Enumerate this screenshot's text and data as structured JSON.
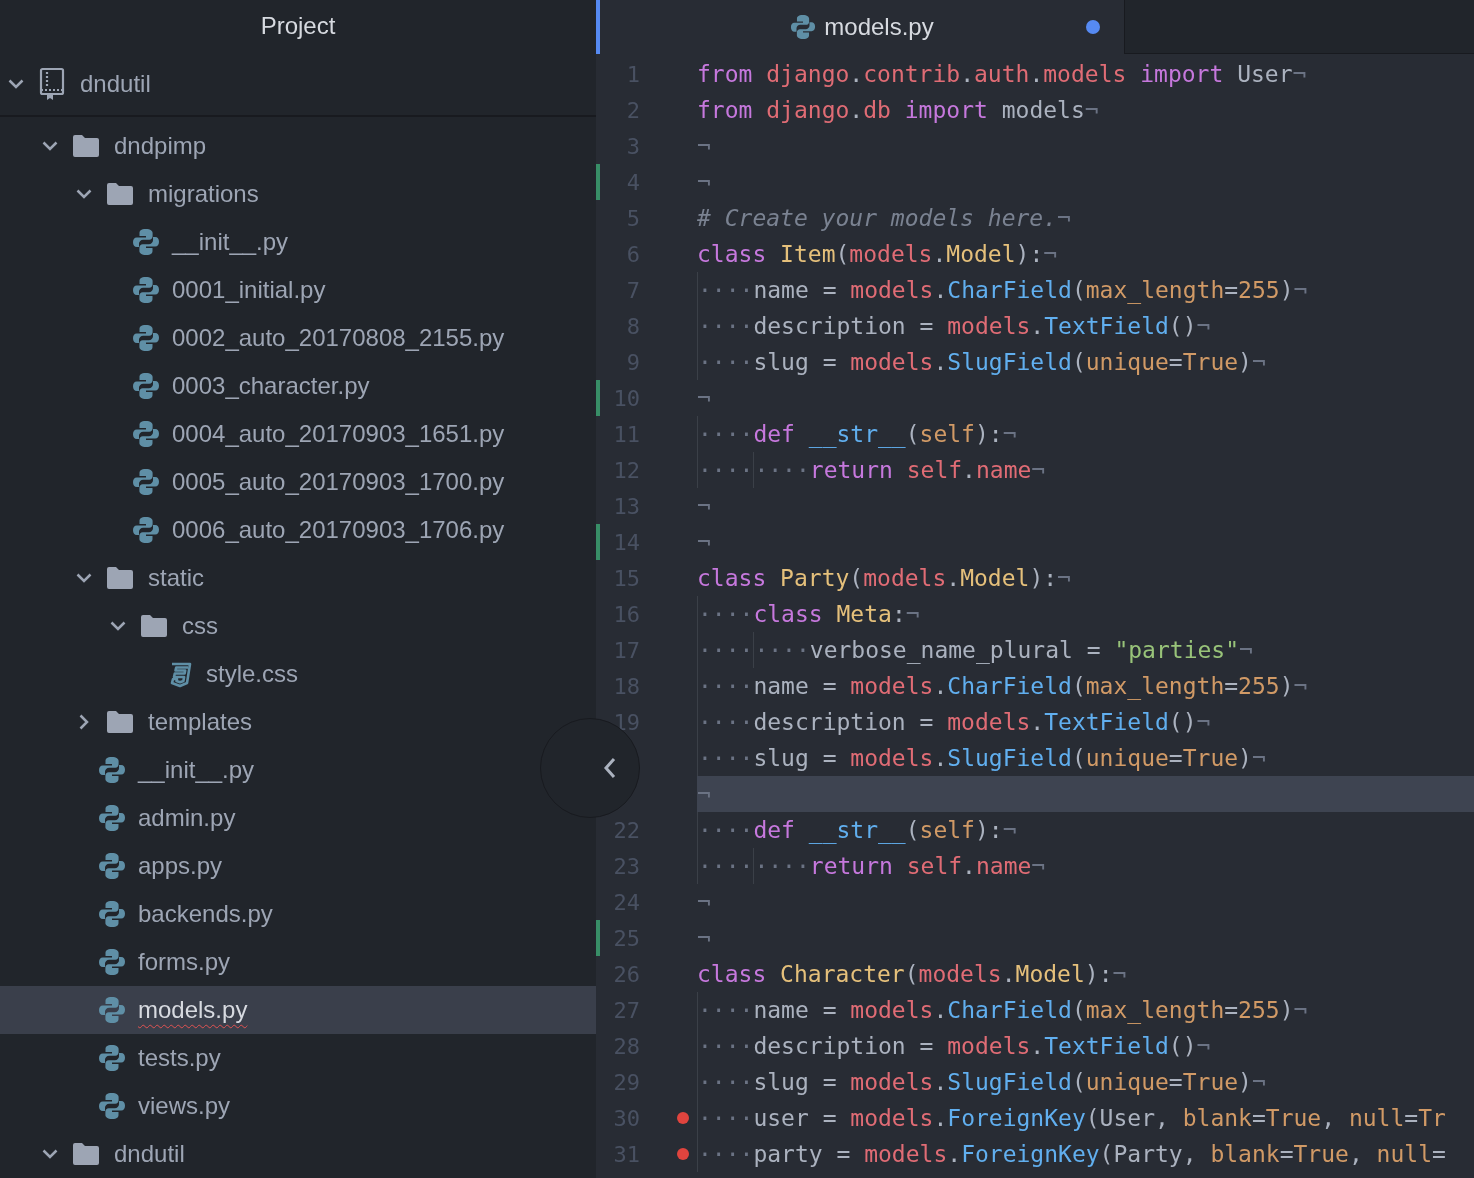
{
  "sidebar": {
    "title": "Project",
    "root": {
      "name": "dndutil",
      "kind": "repo",
      "expanded": true,
      "children": [
        {
          "name": "dndpimp",
          "kind": "folder",
          "expanded": true,
          "children": [
            {
              "name": "migrations",
              "kind": "folder",
              "expanded": true,
              "children": [
                {
                  "name": "__init__.py",
                  "kind": "python",
                  "selected": false,
                  "flagged": false
                },
                {
                  "name": "0001_initial.py",
                  "kind": "python",
                  "selected": false,
                  "flagged": false
                },
                {
                  "name": "0002_auto_20170808_2155.py",
                  "kind": "python",
                  "selected": false,
                  "flagged": false
                },
                {
                  "name": "0003_character.py",
                  "kind": "python",
                  "selected": false,
                  "flagged": false
                },
                {
                  "name": "0004_auto_20170903_1651.py",
                  "kind": "python",
                  "selected": false,
                  "flagged": false
                },
                {
                  "name": "0005_auto_20170903_1700.py",
                  "kind": "python",
                  "selected": false,
                  "flagged": false
                },
                {
                  "name": "0006_auto_20170903_1706.py",
                  "kind": "python",
                  "selected": false,
                  "flagged": false
                }
              ]
            },
            {
              "name": "static",
              "kind": "folder",
              "expanded": true,
              "children": [
                {
                  "name": "css",
                  "kind": "folder",
                  "expanded": true,
                  "children": [
                    {
                      "name": "style.css",
                      "kind": "css",
                      "selected": false,
                      "flagged": false
                    }
                  ]
                }
              ]
            },
            {
              "name": "templates",
              "kind": "folder",
              "expanded": false
            },
            {
              "name": "__init__.py",
              "kind": "python",
              "selected": false,
              "flagged": false
            },
            {
              "name": "admin.py",
              "kind": "python",
              "selected": false,
              "flagged": false
            },
            {
              "name": "apps.py",
              "kind": "python",
              "selected": false,
              "flagged": false
            },
            {
              "name": "backends.py",
              "kind": "python",
              "selected": false,
              "flagged": false
            },
            {
              "name": "forms.py",
              "kind": "python",
              "selected": false,
              "flagged": false
            },
            {
              "name": "models.py",
              "kind": "python",
              "selected": true,
              "flagged": true
            },
            {
              "name": "tests.py",
              "kind": "python",
              "selected": false,
              "flagged": false
            },
            {
              "name": "views.py",
              "kind": "python",
              "selected": false,
              "flagged": false
            }
          ]
        },
        {
          "name": "dndutil",
          "kind": "folder",
          "expanded": true
        }
      ]
    }
  },
  "tab": {
    "title": "models.py",
    "modified": true
  },
  "lines": [
    {
      "number": "1",
      "git_added": false,
      "marker": false,
      "cursor": false,
      "tokens": [
        {
          "text": "from ",
          "kind": "keyword"
        },
        {
          "text": "django",
          "kind": "module"
        },
        {
          "text": ".",
          "kind": "plain"
        },
        {
          "text": "contrib",
          "kind": "module"
        },
        {
          "text": ".",
          "kind": "plain"
        },
        {
          "text": "auth",
          "kind": "module"
        },
        {
          "text": ".",
          "kind": "plain"
        },
        {
          "text": "models ",
          "kind": "module"
        },
        {
          "text": "import ",
          "kind": "keyword"
        },
        {
          "text": "User",
          "kind": "plain"
        },
        {
          "text": "¬",
          "kind": "eol"
        }
      ]
    },
    {
      "number": "2",
      "git_added": false,
      "marker": false,
      "cursor": false,
      "tokens": [
        {
          "text": "from ",
          "kind": "keyword"
        },
        {
          "text": "django",
          "kind": "module"
        },
        {
          "text": ".",
          "kind": "plain"
        },
        {
          "text": "db ",
          "kind": "module"
        },
        {
          "text": "import ",
          "kind": "keyword"
        },
        {
          "text": "models",
          "kind": "plain"
        },
        {
          "text": "¬",
          "kind": "eol"
        }
      ]
    },
    {
      "number": "3",
      "git_added": false,
      "marker": false,
      "cursor": false,
      "tokens": [
        {
          "text": "¬",
          "kind": "eol"
        }
      ]
    },
    {
      "number": "4",
      "git_added": true,
      "marker": false,
      "cursor": false,
      "tokens": [
        {
          "text": "¬",
          "kind": "eol"
        }
      ]
    },
    {
      "number": "5",
      "git_added": false,
      "marker": false,
      "cursor": false,
      "tokens": [
        {
          "text": "# Create your models here.",
          "kind": "comment"
        },
        {
          "text": "¬",
          "kind": "eol"
        }
      ]
    },
    {
      "number": "6",
      "git_added": false,
      "marker": false,
      "cursor": false,
      "tokens": [
        {
          "text": "class ",
          "kind": "keyword"
        },
        {
          "text": "Item",
          "kind": "class"
        },
        {
          "text": "(",
          "kind": "plain"
        },
        {
          "text": "models",
          "kind": "module"
        },
        {
          "text": ".",
          "kind": "plain"
        },
        {
          "text": "Model",
          "kind": "class"
        },
        {
          "text": "):",
          "kind": "plain"
        },
        {
          "text": "¬",
          "kind": "eol"
        }
      ]
    },
    {
      "number": "7",
      "git_added": false,
      "marker": false,
      "cursor": false,
      "tokens": [
        {
          "text": "····",
          "kind": "indent"
        },
        {
          "text": "name = ",
          "kind": "plain"
        },
        {
          "text": "models",
          "kind": "module"
        },
        {
          "text": ".",
          "kind": "plain"
        },
        {
          "text": "CharField",
          "kind": "function"
        },
        {
          "text": "(",
          "kind": "plain"
        },
        {
          "text": "max_length",
          "kind": "param"
        },
        {
          "text": "=",
          "kind": "plain"
        },
        {
          "text": "255",
          "kind": "param"
        },
        {
          "text": ")",
          "kind": "plain"
        },
        {
          "text": "¬",
          "kind": "eol"
        }
      ]
    },
    {
      "number": "8",
      "git_added": false,
      "marker": false,
      "cursor": false,
      "tokens": [
        {
          "text": "····",
          "kind": "indent"
        },
        {
          "text": "description = ",
          "kind": "plain"
        },
        {
          "text": "models",
          "kind": "module"
        },
        {
          "text": ".",
          "kind": "plain"
        },
        {
          "text": "TextField",
          "kind": "function"
        },
        {
          "text": "()",
          "kind": "plain"
        },
        {
          "text": "¬",
          "kind": "eol"
        }
      ]
    },
    {
      "number": "9",
      "git_added": false,
      "marker": false,
      "cursor": false,
      "tokens": [
        {
          "text": "····",
          "kind": "indent"
        },
        {
          "text": "slug = ",
          "kind": "plain"
        },
        {
          "text": "models",
          "kind": "module"
        },
        {
          "text": ".",
          "kind": "plain"
        },
        {
          "text": "SlugField",
          "kind": "function"
        },
        {
          "text": "(",
          "kind": "plain"
        },
        {
          "text": "unique",
          "kind": "param"
        },
        {
          "text": "=",
          "kind": "plain"
        },
        {
          "text": "True",
          "kind": "param"
        },
        {
          "text": ")",
          "kind": "plain"
        },
        {
          "text": "¬",
          "kind": "eol"
        }
      ]
    },
    {
      "number": "10",
      "git_added": true,
      "marker": false,
      "cursor": false,
      "tokens": [
        {
          "text": "¬",
          "kind": "eol"
        }
      ]
    },
    {
      "number": "11",
      "git_added": false,
      "marker": false,
      "cursor": false,
      "tokens": [
        {
          "text": "····",
          "kind": "indent"
        },
        {
          "text": "def ",
          "kind": "keyword"
        },
        {
          "text": "__str__",
          "kind": "function"
        },
        {
          "text": "(",
          "kind": "plain"
        },
        {
          "text": "self",
          "kind": "param"
        },
        {
          "text": "):",
          "kind": "plain"
        },
        {
          "text": "¬",
          "kind": "eol"
        }
      ]
    },
    {
      "number": "12",
      "git_added": false,
      "marker": false,
      "cursor": false,
      "tokens": [
        {
          "text": "····",
          "kind": "indent"
        },
        {
          "text": "····",
          "kind": "indent"
        },
        {
          "text": "return ",
          "kind": "keyword"
        },
        {
          "text": "self",
          "kind": "module"
        },
        {
          "text": ".",
          "kind": "plain"
        },
        {
          "text": "name",
          "kind": "module"
        },
        {
          "text": "¬",
          "kind": "eol"
        }
      ]
    },
    {
      "number": "13",
      "git_added": false,
      "marker": false,
      "cursor": false,
      "tokens": [
        {
          "text": "¬",
          "kind": "eol"
        }
      ]
    },
    {
      "number": "14",
      "git_added": true,
      "marker": false,
      "cursor": false,
      "tokens": [
        {
          "text": "¬",
          "kind": "eol"
        }
      ]
    },
    {
      "number": "15",
      "git_added": false,
      "marker": false,
      "cursor": false,
      "tokens": [
        {
          "text": "class ",
          "kind": "keyword"
        },
        {
          "text": "Party",
          "kind": "class"
        },
        {
          "text": "(",
          "kind": "plain"
        },
        {
          "text": "models",
          "kind": "module"
        },
        {
          "text": ".",
          "kind": "plain"
        },
        {
          "text": "Model",
          "kind": "class"
        },
        {
          "text": "):",
          "kind": "plain"
        },
        {
          "text": "¬",
          "kind": "eol"
        }
      ]
    },
    {
      "number": "16",
      "git_added": false,
      "marker": false,
      "cursor": false,
      "tokens": [
        {
          "text": "····",
          "kind": "indent"
        },
        {
          "text": "class ",
          "kind": "keyword"
        },
        {
          "text": "Meta",
          "kind": "class"
        },
        {
          "text": ":",
          "kind": "plain"
        },
        {
          "text": "¬",
          "kind": "eol"
        }
      ]
    },
    {
      "number": "17",
      "git_added": false,
      "marker": false,
      "cursor": false,
      "tokens": [
        {
          "text": "····",
          "kind": "indent"
        },
        {
          "text": "····",
          "kind": "indent"
        },
        {
          "text": "verbose_name_plural = ",
          "kind": "plain"
        },
        {
          "text": "\"parties\"",
          "kind": "string"
        },
        {
          "text": "¬",
          "kind": "eol"
        }
      ]
    },
    {
      "number": "18",
      "git_added": false,
      "marker": false,
      "cursor": false,
      "tokens": [
        {
          "text": "····",
          "kind": "indent"
        },
        {
          "text": "name = ",
          "kind": "plain"
        },
        {
          "text": "models",
          "kind": "module"
        },
        {
          "text": ".",
          "kind": "plain"
        },
        {
          "text": "CharField",
          "kind": "function"
        },
        {
          "text": "(",
          "kind": "plain"
        },
        {
          "text": "max_length",
          "kind": "param"
        },
        {
          "text": "=",
          "kind": "plain"
        },
        {
          "text": "255",
          "kind": "param"
        },
        {
          "text": ")",
          "kind": "plain"
        },
        {
          "text": "¬",
          "kind": "eol"
        }
      ]
    },
    {
      "number": "19",
      "git_added": false,
      "marker": false,
      "cursor": false,
      "tokens": [
        {
          "text": "····",
          "kind": "indent"
        },
        {
          "text": "description = ",
          "kind": "plain"
        },
        {
          "text": "models",
          "kind": "module"
        },
        {
          "text": ".",
          "kind": "plain"
        },
        {
          "text": "TextField",
          "kind": "function"
        },
        {
          "text": "()",
          "kind": "plain"
        },
        {
          "text": "¬",
          "kind": "eol"
        }
      ]
    },
    {
      "git_added": false,
      "marker": false,
      "cursor": false,
      "tokens": [
        {
          "text": "····",
          "kind": "indent"
        },
        {
          "text": "slug = ",
          "kind": "plain"
        },
        {
          "text": "models",
          "kind": "module"
        },
        {
          "text": ".",
          "kind": "plain"
        },
        {
          "text": "SlugField",
          "kind": "function"
        },
        {
          "text": "(",
          "kind": "plain"
        },
        {
          "text": "unique",
          "kind": "param"
        },
        {
          "text": "=",
          "kind": "plain"
        },
        {
          "text": "True",
          "kind": "param"
        },
        {
          "text": ")",
          "kind": "plain"
        },
        {
          "text": "¬",
          "kind": "eol"
        }
      ]
    },
    {
      "git_added": false,
      "marker": false,
      "cursor": true,
      "tokens": [
        {
          "text": "¬",
          "kind": "eol"
        }
      ]
    },
    {
      "number": "22",
      "git_added": false,
      "marker": false,
      "cursor": false,
      "tokens": [
        {
          "text": "····",
          "kind": "indent"
        },
        {
          "text": "def ",
          "kind": "keyword"
        },
        {
          "text": "__str__",
          "kind": "function"
        },
        {
          "text": "(",
          "kind": "plain"
        },
        {
          "text": "self",
          "kind": "param"
        },
        {
          "text": "):",
          "kind": "plain"
        },
        {
          "text": "¬",
          "kind": "eol"
        }
      ]
    },
    {
      "number": "23",
      "git_added": false,
      "marker": false,
      "cursor": false,
      "tokens": [
        {
          "text": "····",
          "kind": "indent"
        },
        {
          "text": "····",
          "kind": "indent"
        },
        {
          "text": "return ",
          "kind": "keyword"
        },
        {
          "text": "self",
          "kind": "module"
        },
        {
          "text": ".",
          "kind": "plain"
        },
        {
          "text": "name",
          "kind": "module"
        },
        {
          "text": "¬",
          "kind": "eol"
        }
      ]
    },
    {
      "number": "24",
      "git_added": false,
      "marker": false,
      "cursor": false,
      "tokens": [
        {
          "text": "¬",
          "kind": "eol"
        }
      ]
    },
    {
      "number": "25",
      "git_added": true,
      "marker": false,
      "cursor": false,
      "tokens": [
        {
          "text": "¬",
          "kind": "eol"
        }
      ]
    },
    {
      "number": "26",
      "git_added": false,
      "marker": false,
      "cursor": false,
      "tokens": [
        {
          "text": "class ",
          "kind": "keyword"
        },
        {
          "text": "Character",
          "kind": "class"
        },
        {
          "text": "(",
          "kind": "plain"
        },
        {
          "text": "models",
          "kind": "module"
        },
        {
          "text": ".",
          "kind": "plain"
        },
        {
          "text": "Model",
          "kind": "class"
        },
        {
          "text": "):",
          "kind": "plain"
        },
        {
          "text": "¬",
          "kind": "eol"
        }
      ]
    },
    {
      "number": "27",
      "git_added": false,
      "marker": false,
      "cursor": false,
      "tokens": [
        {
          "text": "····",
          "kind": "indent"
        },
        {
          "text": "name = ",
          "kind": "plain"
        },
        {
          "text": "models",
          "kind": "module"
        },
        {
          "text": ".",
          "kind": "plain"
        },
        {
          "text": "CharField",
          "kind": "function"
        },
        {
          "text": "(",
          "kind": "plain"
        },
        {
          "text": "max_length",
          "kind": "param"
        },
        {
          "text": "=",
          "kind": "plain"
        },
        {
          "text": "255",
          "kind": "param"
        },
        {
          "text": ")",
          "kind": "plain"
        },
        {
          "text": "¬",
          "kind": "eol"
        }
      ]
    },
    {
      "number": "28",
      "git_added": false,
      "marker": false,
      "cursor": false,
      "tokens": [
        {
          "text": "····",
          "kind": "indent"
        },
        {
          "text": "description = ",
          "kind": "plain"
        },
        {
          "text": "models",
          "kind": "module"
        },
        {
          "text": ".",
          "kind": "plain"
        },
        {
          "text": "TextField",
          "kind": "function"
        },
        {
          "text": "()",
          "kind": "plain"
        },
        {
          "text": "¬",
          "kind": "eol"
        }
      ]
    },
    {
      "number": "29",
      "git_added": false,
      "marker": false,
      "cursor": false,
      "tokens": [
        {
          "text": "····",
          "kind": "indent"
        },
        {
          "text": "slug = ",
          "kind": "plain"
        },
        {
          "text": "models",
          "kind": "module"
        },
        {
          "text": ".",
          "kind": "plain"
        },
        {
          "text": "SlugField",
          "kind": "function"
        },
        {
          "text": "(",
          "kind": "plain"
        },
        {
          "text": "unique",
          "kind": "param"
        },
        {
          "text": "=",
          "kind": "plain"
        },
        {
          "text": "True",
          "kind": "param"
        },
        {
          "text": ")",
          "kind": "plain"
        },
        {
          "text": "¬",
          "kind": "eol"
        }
      ]
    },
    {
      "number": "30",
      "git_added": false,
      "marker": true,
      "cursor": false,
      "tokens": [
        {
          "text": "····",
          "kind": "indent"
        },
        {
          "text": "user = ",
          "kind": "plain"
        },
        {
          "text": "models",
          "kind": "module"
        },
        {
          "text": ".",
          "kind": "plain"
        },
        {
          "text": "ForeignKey",
          "kind": "function"
        },
        {
          "text": "(User, ",
          "kind": "plain"
        },
        {
          "text": "blank",
          "kind": "param"
        },
        {
          "text": "=",
          "kind": "plain"
        },
        {
          "text": "True",
          "kind": "param"
        },
        {
          "text": ", ",
          "kind": "plain"
        },
        {
          "text": "null",
          "kind": "param"
        },
        {
          "text": "=",
          "kind": "plain"
        },
        {
          "text": "Tr",
          "kind": "param"
        }
      ]
    },
    {
      "number": "31",
      "git_added": false,
      "marker": true,
      "cursor": false,
      "tokens": [
        {
          "text": "····",
          "kind": "indent"
        },
        {
          "text": "party = ",
          "kind": "plain"
        },
        {
          "text": "models",
          "kind": "module"
        },
        {
          "text": ".",
          "kind": "plain"
        },
        {
          "text": "ForeignKey",
          "kind": "function"
        },
        {
          "text": "(Party, ",
          "kind": "plain"
        },
        {
          "text": "blank",
          "kind": "param"
        },
        {
          "text": "=",
          "kind": "plain"
        },
        {
          "text": "True",
          "kind": "param"
        },
        {
          "text": ", ",
          "kind": "plain"
        },
        {
          "text": "null",
          "kind": "param"
        },
        {
          "text": "=",
          "kind": "plain"
        }
      ]
    }
  ]
}
